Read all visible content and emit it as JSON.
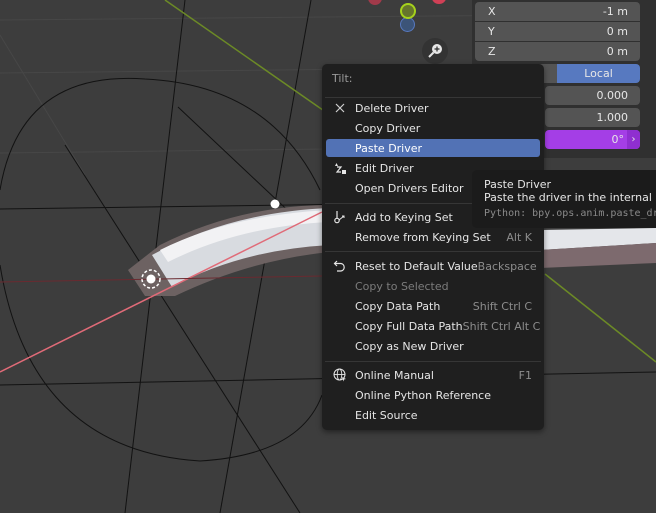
{
  "viewport": {
    "colors": {
      "background": "#3d3d3d",
      "x_axis": "#e06070",
      "y_axis": "#7a9a2a",
      "curve_white": "#e8e8ea"
    }
  },
  "npanel": {
    "vector": [
      {
        "axis": "X",
        "value": "-1 m"
      },
      {
        "axis": "Y",
        "value": "0 m"
      },
      {
        "axis": "Z",
        "value": "0 m"
      }
    ],
    "space_selected": "Local",
    "weight": "0.000",
    "radius": "1.000",
    "tilt": "0°",
    "tilt_color": "#a43ee6",
    "tilt_arrow": "›"
  },
  "gizmo": {
    "zoom_icon": "magnifier-plus-icon"
  },
  "menu": {
    "title": "Tilt:",
    "items": [
      {
        "label": "Delete Driver",
        "icon": "x-icon",
        "shortcut": ""
      },
      {
        "label": "Copy Driver",
        "shortcut": ""
      },
      {
        "label": "Paste Driver",
        "shortcut": "",
        "active": true
      },
      {
        "label": "Edit Driver",
        "icon": "driver-icon",
        "shortcut": ""
      },
      {
        "label": "Open Drivers Editor",
        "shortcut": ""
      },
      {
        "label": "Add to Keying Set",
        "icon": "keying-set-icon",
        "shortcut": ""
      },
      {
        "label": "Remove from Keying Set",
        "shortcut": "Alt K"
      },
      {
        "label": "Reset to Default Value",
        "icon": "reset-icon",
        "shortcut": "Backspace"
      },
      {
        "label": "Copy to Selected",
        "shortcut": "",
        "disabled": true
      },
      {
        "label": "Copy Data Path",
        "shortcut": "Shift Ctrl C"
      },
      {
        "label": "Copy Full Data Path",
        "shortcut": "Shift Ctrl Alt C"
      },
      {
        "label": "Copy as New Driver",
        "shortcut": ""
      },
      {
        "label": "Online Manual",
        "icon": "globe-icon",
        "shortcut": "F1"
      },
      {
        "label": "Online Python Reference",
        "shortcut": ""
      },
      {
        "label": "Edit Source",
        "shortcut": ""
      }
    ],
    "highlight_color": "#5272b5"
  },
  "tooltip": {
    "title": "Paste Driver",
    "description": "Paste the driver in the internal clip",
    "python": "Python: bpy.ops.anim.paste_dr"
  }
}
